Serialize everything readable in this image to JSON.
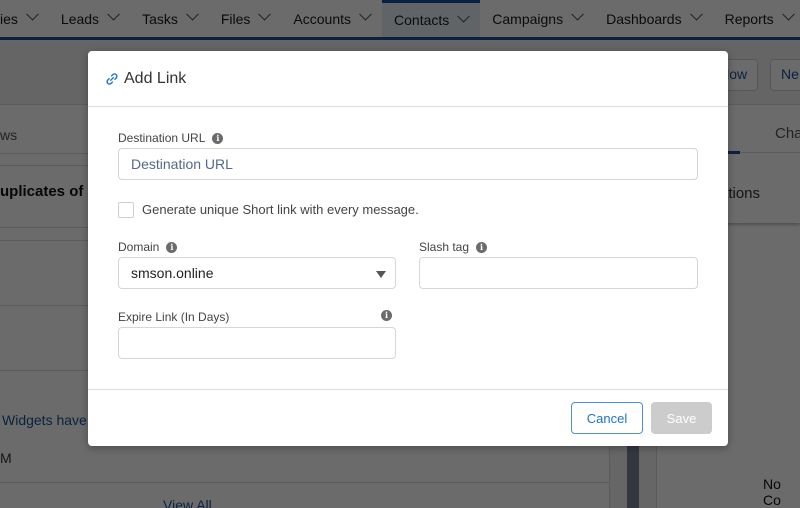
{
  "nav": {
    "items": [
      {
        "label": "ies"
      },
      {
        "label": "Leads"
      },
      {
        "label": "Tasks"
      },
      {
        "label": "Files"
      },
      {
        "label": "Accounts"
      },
      {
        "label": "Contacts",
        "active": true
      },
      {
        "label": "Campaigns"
      },
      {
        "label": "Dashboards"
      },
      {
        "label": "Reports"
      }
    ]
  },
  "background": {
    "header_buttons": [
      "llow",
      "Ne"
    ],
    "left_tab": "ws",
    "section_title": "uplicates of",
    "widgets_link": "Widgets have n",
    "row_text": "M",
    "view_all": "View All",
    "right_tab": "Cha",
    "right_card": "ations",
    "right_empty": "No Co"
  },
  "modal": {
    "title": "Add Link",
    "destination_url": {
      "label": "Destination URL",
      "placeholder": "Destination URL",
      "value": ""
    },
    "short_link_checkbox": {
      "label": "Generate unique Short link with every message.",
      "checked": false
    },
    "domain": {
      "label": "Domain",
      "selected": "smson.online"
    },
    "slash_tag": {
      "label": "Slash tag",
      "value": ""
    },
    "expire_link": {
      "label": "Expire Link (In Days)",
      "value": ""
    },
    "buttons": {
      "cancel": "Cancel",
      "save": "Save"
    },
    "info_glyph": "i"
  },
  "colors": {
    "brand": "#1b5297",
    "link": "#1b73c9",
    "save_disabled": "#cccccc"
  }
}
